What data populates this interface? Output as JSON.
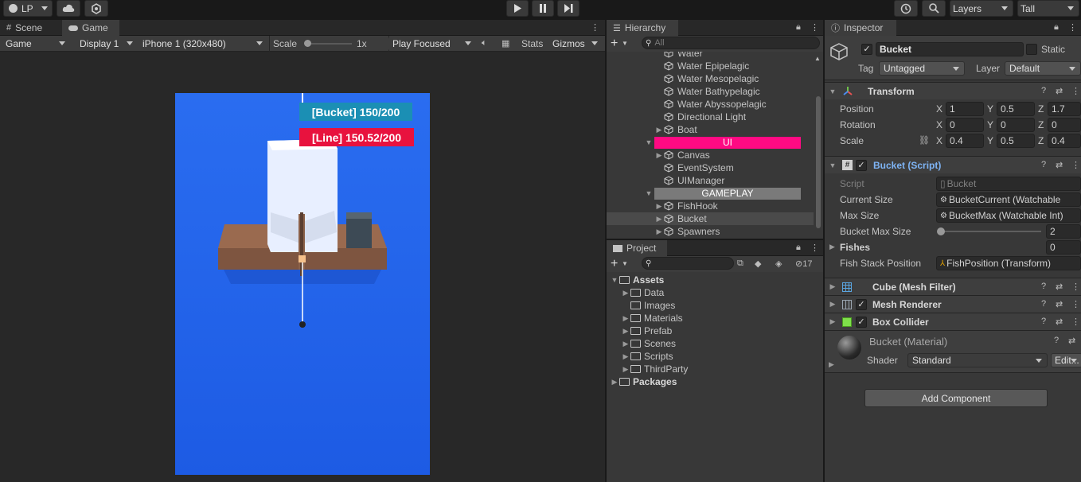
{
  "toolbar": {
    "account_label": "LP",
    "layers_label": "Layers",
    "layout_label": "Tall"
  },
  "scene_game": {
    "tabs": [
      "Scene",
      "Game"
    ],
    "game_mode": "Game",
    "display": "Display 1",
    "resolution": "iPhone 1 (320x480)",
    "scale_label": "Scale",
    "scale_value": "1x",
    "play_mode": "Play Focused",
    "stats_label": "Stats",
    "gizmos_label": "Gizmos",
    "hud": {
      "bucket": "[Bucket] 150/200",
      "line": "[Line] 150.52/200",
      "bucket_color": "#1b8fb4",
      "line_color": "#e8123e"
    },
    "sky_color": "#2463e8"
  },
  "hierarchy": {
    "title": "Hierarchy",
    "search_placeholder": "All",
    "items": [
      {
        "label": "Water",
        "indent": 1,
        "arrow": false
      },
      {
        "label": "Water Epipelagic",
        "indent": 1,
        "arrow": false
      },
      {
        "label": "Water Mesopelagic",
        "indent": 1,
        "arrow": false
      },
      {
        "label": "Water Bathypelagic",
        "indent": 1,
        "arrow": false
      },
      {
        "label": "Water Abyssopelagic",
        "indent": 1,
        "arrow": false
      },
      {
        "label": "Directional Light",
        "indent": 1,
        "arrow": false
      },
      {
        "label": "Boat",
        "indent": 1,
        "arrow": true
      },
      {
        "label": "UI",
        "header": true,
        "color": "#ff0a83"
      },
      {
        "label": "Canvas",
        "indent": 1,
        "arrow": true
      },
      {
        "label": "EventSystem",
        "indent": 1,
        "arrow": false
      },
      {
        "label": "UIManager",
        "indent": 1,
        "arrow": false
      },
      {
        "label": "GAMEPLAY",
        "header": true,
        "color": "#7a7a7a"
      },
      {
        "label": "FishHook",
        "indent": 1,
        "arrow": true
      },
      {
        "label": "Bucket",
        "indent": 1,
        "arrow": true,
        "selected": true
      },
      {
        "label": "Spawners",
        "indent": 1,
        "arrow": true
      }
    ]
  },
  "project": {
    "title": "Project",
    "hidden_count": "17",
    "tree": [
      {
        "label": "Assets",
        "level": 0,
        "arrow": "open",
        "bold": true
      },
      {
        "label": "Data",
        "level": 1,
        "arrow": "closed"
      },
      {
        "label": "Images",
        "level": 1,
        "arrow": "none"
      },
      {
        "label": "Materials",
        "level": 1,
        "arrow": "closed"
      },
      {
        "label": "Prefab",
        "level": 1,
        "arrow": "closed"
      },
      {
        "label": "Scenes",
        "level": 1,
        "arrow": "closed"
      },
      {
        "label": "Scripts",
        "level": 1,
        "arrow": "closed"
      },
      {
        "label": "ThirdParty",
        "level": 1,
        "arrow": "closed"
      },
      {
        "label": "Packages",
        "level": 0,
        "arrow": "closed",
        "bold": true
      }
    ]
  },
  "inspector": {
    "title": "Inspector",
    "object_name": "Bucket",
    "static_label": "Static",
    "tag_label": "Tag",
    "tag_value": "Untagged",
    "layer_label": "Layer",
    "layer_value": "Default",
    "transform": {
      "title": "Transform",
      "position_label": "Position",
      "rotation_label": "Rotation",
      "scale_label": "Scale",
      "position": {
        "x": "1",
        "y": "0.5",
        "z": "1.7"
      },
      "rotation": {
        "x": "0",
        "y": "0",
        "z": "0"
      },
      "scale": {
        "x": "0.4",
        "y": "0.5",
        "z": "0.4"
      },
      "axis_x": "X",
      "axis_y": "Y",
      "axis_z": "Z"
    },
    "bucket_script": {
      "title": "Bucket (Script)",
      "script_label": "Script",
      "script_value": "Bucket",
      "current_size_label": "Current Size",
      "current_size_value": "BucketCurrent (Watchable",
      "max_size_label": "Max Size",
      "max_size_value": "BucketMax (Watchable Int)",
      "bucket_max_size_label": "Bucket Max Size",
      "bucket_max_size_value": "2",
      "bucket_max_size_slider": 0,
      "fishes_label": "Fishes",
      "fishes_value": "0",
      "fish_stack_label": "Fish Stack Position",
      "fish_stack_value": "FishPosition (Transform)"
    },
    "components": {
      "mesh_filter": "Cube (Mesh Filter)",
      "mesh_renderer": "Mesh Renderer",
      "box_collider": "Box Collider"
    },
    "material": {
      "name": "Bucket (Material)",
      "shader_label": "Shader",
      "shader_value": "Standard",
      "edit_label": "Edit..."
    },
    "add_component_label": "Add Component"
  }
}
